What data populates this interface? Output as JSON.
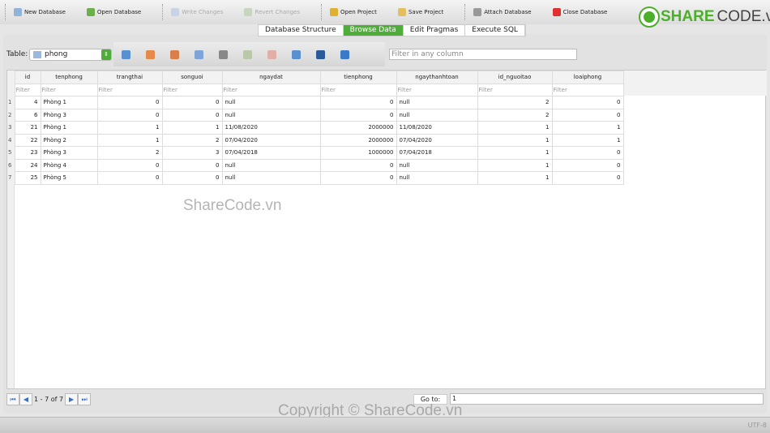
{
  "toolbar": {
    "items": [
      {
        "label": "New Database",
        "icon": "new-database-icon",
        "color": "#8fb3d9",
        "enabled": true
      },
      {
        "label": "Open Database",
        "icon": "open-database-icon",
        "color": "#6bb04a",
        "enabled": true
      },
      {
        "label": "Write Changes",
        "icon": "write-changes-icon",
        "color": "#c8d4e6",
        "enabled": false
      },
      {
        "label": "Revert Changes",
        "icon": "revert-changes-icon",
        "color": "#c8d6c0",
        "enabled": false
      },
      {
        "label": "Open Project",
        "icon": "open-project-icon",
        "color": "#e0b030",
        "enabled": true
      },
      {
        "label": "Save Project",
        "icon": "save-project-icon",
        "color": "#e0c060",
        "enabled": true
      },
      {
        "label": "Attach Database",
        "icon": "attach-database-icon",
        "color": "#999999",
        "enabled": true
      },
      {
        "label": "Close Database",
        "icon": "close-icon",
        "color": "#e03030",
        "enabled": true
      }
    ]
  },
  "logo": {
    "brand": "SHARE",
    "suffix": "CODE.vn"
  },
  "tabs": [
    {
      "label": "Database Structure",
      "active": false
    },
    {
      "label": "Browse Data",
      "active": true
    },
    {
      "label": "Edit Pragmas",
      "active": false
    },
    {
      "label": "Execute SQL",
      "active": false
    }
  ],
  "browse": {
    "table_label": "Table:",
    "table_value": "phong",
    "filter_any_placeholder": "Filter in any column",
    "columns": [
      "id",
      "tenphong",
      "trangthai",
      "songuoi",
      "ngaydat",
      "tienphong",
      "ngaythanhtoan",
      "id_nguoitao",
      "loaiphong"
    ],
    "filter_placeholder": "Filter",
    "rows": [
      [
        "4",
        "Phòng 1",
        "0",
        "0",
        "null",
        "0",
        "null",
        "2",
        "0"
      ],
      [
        "6",
        "Phòng 3",
        "0",
        "0",
        "null",
        "0",
        "null",
        "2",
        "0"
      ],
      [
        "21",
        "Phòng 1",
        "1",
        "1",
        "11/08/2020",
        "2000000",
        "11/08/2020",
        "1",
        "1"
      ],
      [
        "22",
        "Phòng 2",
        "1",
        "2",
        "07/04/2020",
        "2000000",
        "07/04/2020",
        "1",
        "1"
      ],
      [
        "23",
        "Phòng 3",
        "2",
        "3",
        "07/04/2018",
        "1000000",
        "07/04/2018",
        "1",
        "0"
      ],
      [
        "24",
        "Phòng 4",
        "0",
        "0",
        "null",
        "0",
        "null",
        "1",
        "0"
      ],
      [
        "25",
        "Phòng 5",
        "0",
        "0",
        "null",
        "0",
        "null",
        "1",
        "0"
      ]
    ]
  },
  "pager": {
    "range": "1 - 7 of 7",
    "goto_label": "Go to:",
    "goto_value": "1"
  },
  "status": {
    "encoding": "UTF-8"
  },
  "watermark": {
    "center": "ShareCode.vn",
    "bottom": "Copyright © ShareCode.vn"
  },
  "accent": "#4fae3a"
}
